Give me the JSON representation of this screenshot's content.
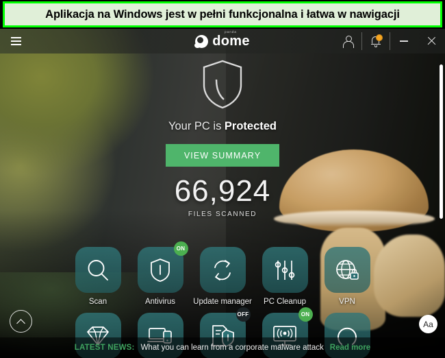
{
  "banner": {
    "text": "Aplikacja na Windows jest w pełni funkcjonalna i łatwa w nawigacji",
    "border_color": "#00ff00",
    "fill_color": "#e0efd8"
  },
  "titlebar": {
    "menu_icon": "hamburger-icon",
    "logo_text": "dome",
    "logo_sub": "panda",
    "user_icon": "user-icon",
    "bell_icon": "bell-icon",
    "bell_badge_color": "#f6a622",
    "minimize_label": "minimize-icon",
    "close_label": "close-icon"
  },
  "hero": {
    "shield_icon": "shield-icon",
    "status_prefix": "Your PC is ",
    "status_state": "Protected",
    "summary_button": "VIEW SUMMARY",
    "summary_button_color": "#4fb56b",
    "scan_count": "66,924",
    "scan_label": "FILES SCANNED"
  },
  "tiles": {
    "row1": [
      {
        "label": "Scan",
        "icon": "search-icon",
        "badge": null
      },
      {
        "label": "Antivirus",
        "icon": "shield-icon",
        "badge": "ON"
      },
      {
        "label": "Update manager",
        "icon": "sync-icon",
        "badge": null
      },
      {
        "label": "PC Cleanup",
        "icon": "sliders-icon",
        "badge": null
      },
      {
        "label": "VPN",
        "icon": "globe-lock-icon",
        "badge": null
      }
    ],
    "row2": [
      {
        "label": "",
        "icon": "diamond-icon",
        "badge": null
      },
      {
        "label": "",
        "icon": "devices-icon",
        "badge": null
      },
      {
        "label": "",
        "icon": "document-shield-icon",
        "badge": "OFF"
      },
      {
        "label": "",
        "icon": "wifi-monitor-icon",
        "badge": "ON"
      },
      {
        "label": "",
        "icon": "ring-icon",
        "badge": null
      }
    ],
    "badge_on_color": "#4caf50",
    "badge_off_color": "#1c2326"
  },
  "controls": {
    "scroll_up_icon": "chevron-up-icon",
    "text_size_label": "Aa"
  },
  "news": {
    "label": "LATEST NEWS:",
    "headline": "What you can learn from a corporate malware attack",
    "read_more": "Read more",
    "accent_color": "#3fa35f"
  },
  "scrollbar": {
    "thumb_color": "#ffffff"
  }
}
